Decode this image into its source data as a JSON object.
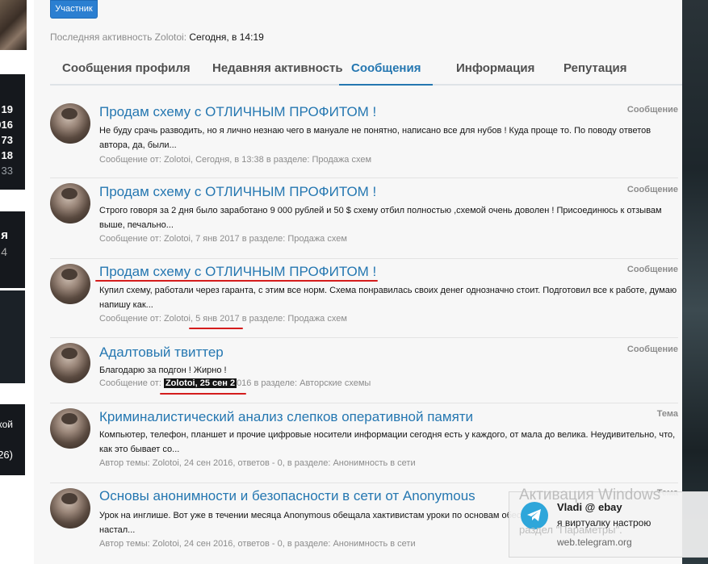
{
  "header": {
    "badge": "Участник",
    "last_activity_label": "Последняя активность Zolotoi:",
    "last_activity_value": "Сегодня, в 14:19"
  },
  "tabs": [
    {
      "label": "Сообщения профиля",
      "active": false
    },
    {
      "label": "Недавняя активность",
      "active": false
    },
    {
      "label": "Сообщения",
      "active": true
    },
    {
      "label": "Информация",
      "active": false
    },
    {
      "label": "Репутация",
      "active": false
    }
  ],
  "items": [
    {
      "title": "Продам схему с ОТЛИЧНЫМ ПРОФИТОМ !",
      "kind": "Сообщение",
      "excerpt": "Не буду срачь разводить, но я лично незнаю чего в мануале не понятно, написано все для нубов ! Куда проще то. По поводу ответов автора, да, были...",
      "meta_prefix": "Сообщение от: ",
      "meta_author": "Zolotoi",
      "meta_date": ", Сегодня, в 13:38",
      "meta_suffix": " в разделе: Продажа схем"
    },
    {
      "title": "Продам схему с ОТЛИЧНЫМ ПРОФИТОМ !",
      "kind": "Сообщение",
      "excerpt": "Строго говоря за 2 дня было заработано 9 000 рублей и 50 $ схему отбил полностью ,схемой очень доволен ! Присоединюсь к отзывам выше, печально...",
      "meta_prefix": "Сообщение от: ",
      "meta_author": "Zolotoi",
      "meta_date": ", 7 янв 2017",
      "meta_suffix": " в разделе: Продажа схем"
    },
    {
      "title": "Продам схему с ОТЛИЧНЫМ ПРОФИТОМ !",
      "kind": "Сообщение",
      "excerpt": "Купил схему, работали через гаранта, с этим все норм. Схема понравилась своих денег однозначно стоит. Подготовил все к работе, думаю напишу как...",
      "meta_prefix": "Сообщение от: ",
      "meta_author": "Zolotoi",
      "meta_date": ", 5 янв 2017",
      "meta_suffix": " в разделе: Продажа схем"
    },
    {
      "title": "Адалтовый твиттер",
      "kind": "Сообщение",
      "excerpt": "Благодарю за подгон ! Жирно !",
      "meta_prefix": "Сообщение от: ",
      "meta_author": "Zolotoi, 25 сен 2",
      "meta_date": "016",
      "meta_suffix": " в разделе: Авторские схемы"
    },
    {
      "title": "Криминалистический анализ слепков оперативной памяти",
      "kind": "Тема",
      "excerpt": "Компьютер, телефон, планшет и прочие цифровые носители информации сегодня есть у каждого, от мала до велика. Неудивительно, что, как это бывает со...",
      "meta_prefix": "Автор темы: ",
      "meta_author": "Zolotoi",
      "meta_date": ", 24 сен 2016, ответов - 0",
      "meta_suffix": ", в разделе: Анонимность в сети"
    },
    {
      "title": "Основы анонимности и безопасности в сети от Anonymous",
      "kind": "Тема",
      "excerpt": "Урок на инглише. Вот уже в течении месяца Anonymous обещала хактивистам уроки по основам обесп... настал...",
      "meta_prefix": "Автор темы: ",
      "meta_author": "Zolotoi",
      "meta_date": ", 24 сен 2016, ответов - 0",
      "meta_suffix": ", в разделе: Анонимность в сети"
    }
  ],
  "sidebar_fragments": {
    "numbers": [
      "19",
      "016",
      "73",
      "18",
      "33"
    ],
    "big": "я",
    "small": "4",
    "text1": "кой",
    "text2": "26)"
  },
  "overlay": {
    "windows_activation": "Активация Windows",
    "windows_activation_sub": "раздел \"Параметры\".",
    "notification_title": "Vladi @ ebay",
    "notification_text": "я виртуалку настрою",
    "notification_site": "web.telegram.org"
  },
  "colors": {
    "link": "#2577b1",
    "badge": "#2b7fd1",
    "annotation": "#d41c1c",
    "telegram": "#2ea6da"
  }
}
